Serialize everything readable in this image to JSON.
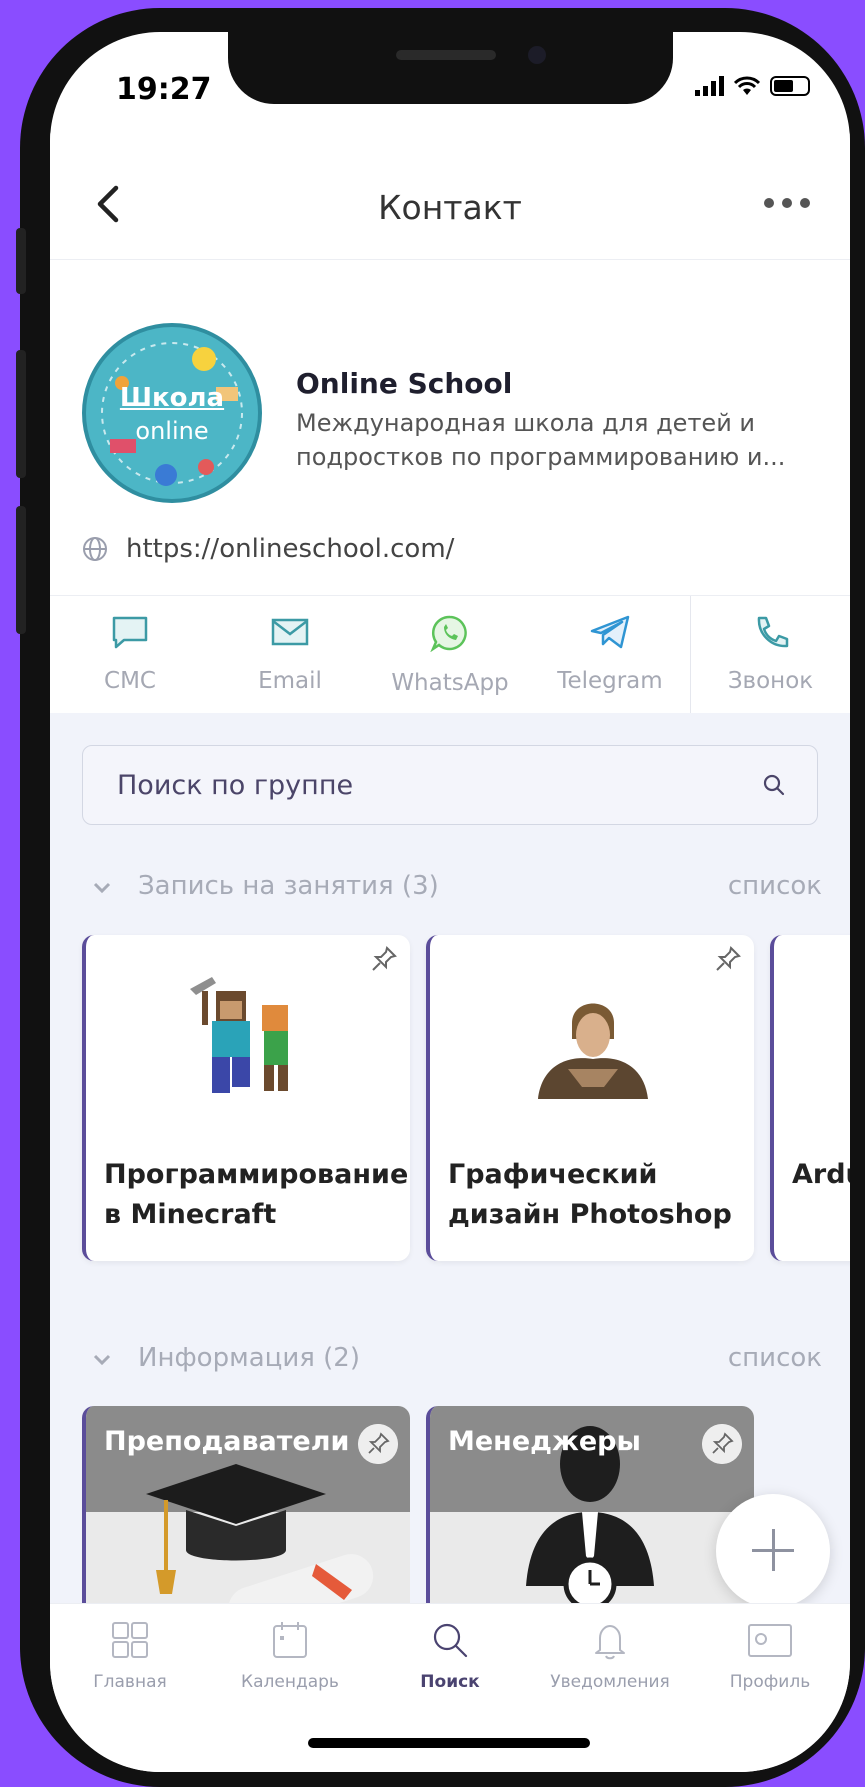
{
  "status": {
    "time": "19:27"
  },
  "header": {
    "title": "Контакт"
  },
  "profile": {
    "avatar_text_top": "Школа",
    "avatar_text_bottom": "online",
    "name": "Online School",
    "description": "Международная школа для детей и подростков по программированию и...",
    "website": "https://onlineschool.com/"
  },
  "actions": [
    {
      "label": "СМС",
      "icon": "chat-bubble-icon"
    },
    {
      "label": "Email",
      "icon": "envelope-icon"
    },
    {
      "label": "WhatsApp",
      "icon": "whatsapp-icon"
    },
    {
      "label": "Telegram",
      "icon": "telegram-icon"
    },
    {
      "label": "Звонок",
      "icon": "phone-icon"
    }
  ],
  "search": {
    "placeholder": "Поиск по группе"
  },
  "sections": [
    {
      "title": "Запись на занятия (3)",
      "link": "список",
      "cards": [
        {
          "title": "Программирование в Minecraft"
        },
        {
          "title": "Графический дизайн Photoshop"
        },
        {
          "title": "Ardu"
        }
      ]
    },
    {
      "title": "Информация (2)",
      "link": "список",
      "cards": [
        {
          "title": "Преподаватели"
        },
        {
          "title": "Менеджеры"
        }
      ]
    }
  ],
  "tabbar": [
    {
      "label": "Главная",
      "icon": "grid-icon"
    },
    {
      "label": "Календарь",
      "icon": "calendar-icon"
    },
    {
      "label": "Поиск",
      "icon": "search-icon"
    },
    {
      "label": "Уведомления",
      "icon": "bell-icon"
    },
    {
      "label": "Профиль",
      "icon": "profile-card-icon"
    }
  ],
  "colors": {
    "accent": "#5b4d9a",
    "background": "#8a4dff",
    "green": "#5cc35a",
    "teal": "#2f8ea0"
  }
}
